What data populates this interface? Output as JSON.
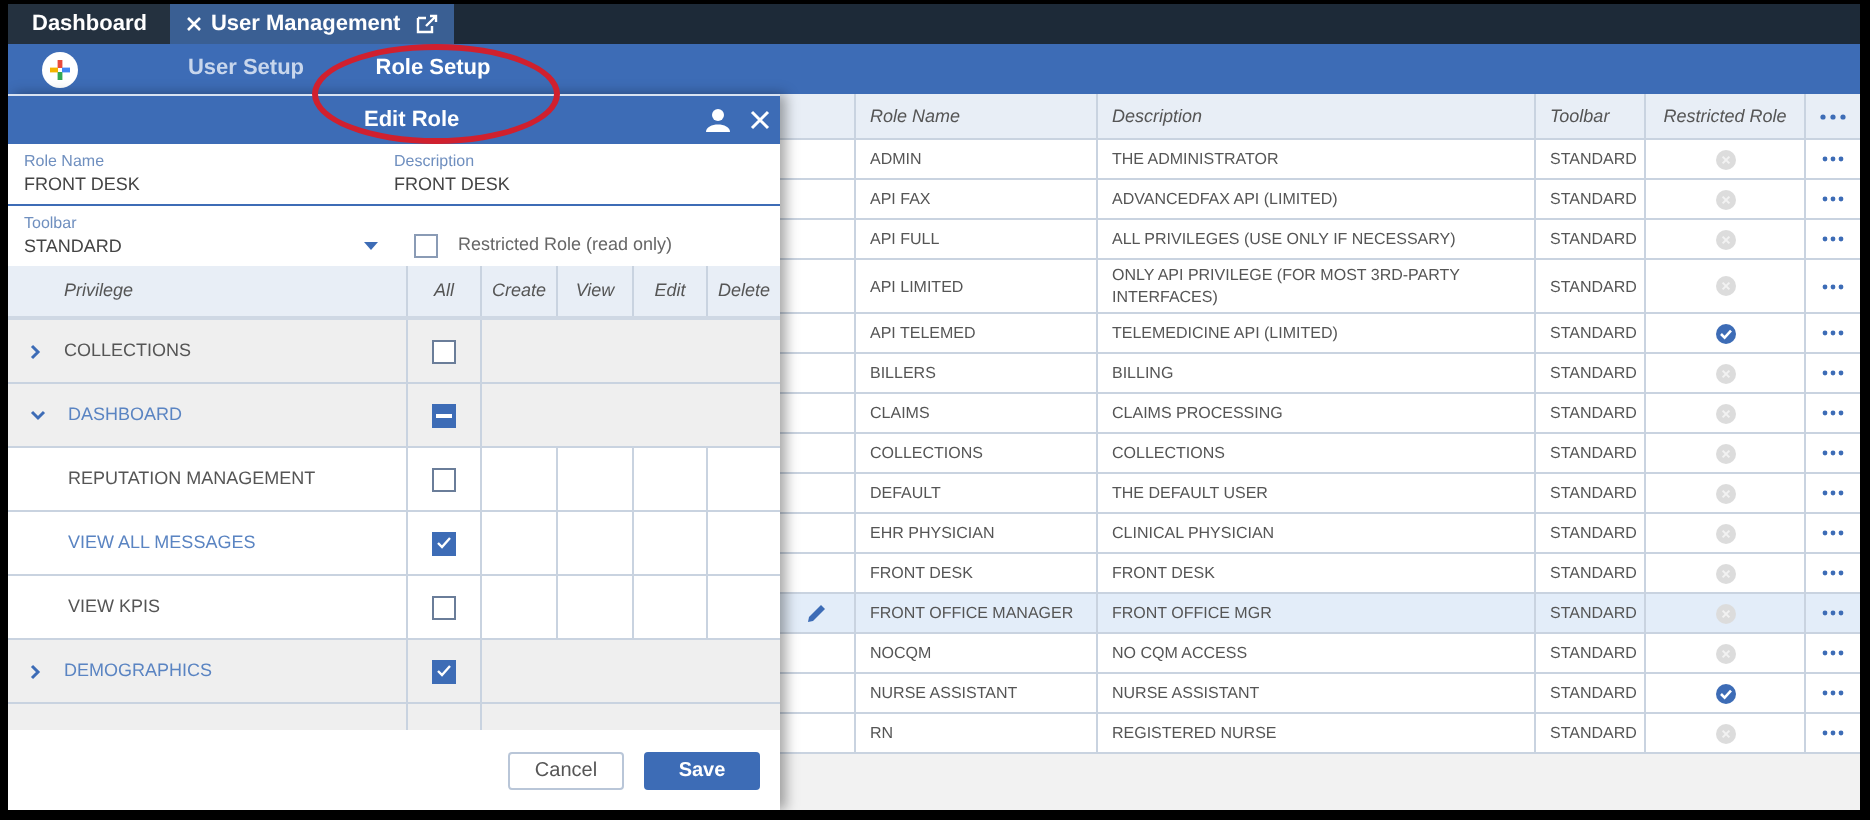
{
  "tabs": [
    {
      "label": "Dashboard",
      "selected": false
    },
    {
      "label": "User Management",
      "selected": true
    }
  ],
  "nav": [
    {
      "label": "User Setup",
      "selected": false
    },
    {
      "label": "Role Setup",
      "selected": true
    }
  ],
  "panel": {
    "title": "Edit Role",
    "fields": [
      {
        "label": "Role Name",
        "value": "FRONT DESK"
      },
      {
        "label": "Description",
        "value": "FRONT DESK"
      }
    ],
    "toolbar": {
      "label": "Toolbar",
      "value": "STANDARD"
    },
    "restricted": {
      "label": "Restricted Role (read only)",
      "checked": false
    },
    "columns": [
      "Privilege",
      "All",
      "Create",
      "View",
      "Edit",
      "Delete"
    ],
    "privileges": [
      {
        "label": "COLLECTIONS",
        "checked": false,
        "partial": false,
        "expanded": false
      },
      {
        "label": "DASHBOARD",
        "checked": true,
        "partial": true,
        "expanded": true,
        "children": [
          {
            "label": "REPUTATION MANAGEMENT",
            "checked": false,
            "partial": false
          },
          {
            "label": "VIEW ALL MESSAGES",
            "checked": true,
            "partial": false
          },
          {
            "label": "VIEW KPIS",
            "checked": false,
            "partial": false
          }
        ]
      },
      {
        "label": "DEMOGRAPHICS",
        "checked": true,
        "partial": false,
        "expanded": false
      }
    ],
    "buttons": [
      {
        "label": "Cancel",
        "kind": "secondary"
      },
      {
        "label": "Save",
        "kind": "primary"
      }
    ]
  },
  "roles": {
    "columns": [
      "Role Name",
      "Description",
      "Toolbar",
      "Restricted Role"
    ],
    "rows": [
      {
        "name": "ADMIN",
        "description": "THE ADMINISTRATOR",
        "toolbar": "STANDARD",
        "restricted": false,
        "selected": false
      },
      {
        "name": "API FAX",
        "description": "ADVANCEDFAX API (LIMITED)",
        "toolbar": "STANDARD",
        "restricted": false,
        "selected": false
      },
      {
        "name": "API FULL",
        "description": "ALL PRIVILEGES (USE ONLY IF NECESSARY)",
        "toolbar": "STANDARD",
        "restricted": false,
        "selected": false
      },
      {
        "name": "API LIMITED",
        "description": "ONLY API PRIVILEGE (FOR MOST 3RD-PARTY INTERFACES)",
        "toolbar": "STANDARD",
        "restricted": false,
        "selected": false
      },
      {
        "name": "API TELEMED",
        "description": "TELEMEDICINE API (LIMITED)",
        "toolbar": "STANDARD",
        "restricted": true,
        "selected": false
      },
      {
        "name": "BILLERS",
        "description": "BILLING",
        "toolbar": "STANDARD",
        "restricted": false,
        "selected": false
      },
      {
        "name": "CLAIMS",
        "description": "CLAIMS PROCESSING",
        "toolbar": "STANDARD",
        "restricted": false,
        "selected": false
      },
      {
        "name": "COLLECTIONS",
        "description": "COLLECTIONS",
        "toolbar": "STANDARD",
        "restricted": false,
        "selected": false
      },
      {
        "name": "DEFAULT",
        "description": "THE DEFAULT USER",
        "toolbar": "STANDARD",
        "restricted": false,
        "selected": false
      },
      {
        "name": "EHR PHYSICIAN",
        "description": "CLINICAL PHYSICIAN",
        "toolbar": "STANDARD",
        "restricted": false,
        "selected": false
      },
      {
        "name": "FRONT DESK",
        "description": "FRONT DESK",
        "toolbar": "STANDARD",
        "restricted": false,
        "selected": false
      },
      {
        "name": "FRONT OFFICE MANAGER",
        "description": "FRONT OFFICE MGR",
        "toolbar": "STANDARD",
        "restricted": false,
        "selected": true
      },
      {
        "name": "NOCQM",
        "description": "NO CQM ACCESS",
        "toolbar": "STANDARD",
        "restricted": false,
        "selected": false
      },
      {
        "name": "NURSE ASSISTANT",
        "description": "NURSE ASSISTANT",
        "toolbar": "STANDARD",
        "restricted": true,
        "selected": false
      },
      {
        "name": "RN",
        "description": "REGISTERED NURSE",
        "toolbar": "STANDARD",
        "restricted": false,
        "selected": false
      }
    ]
  }
}
